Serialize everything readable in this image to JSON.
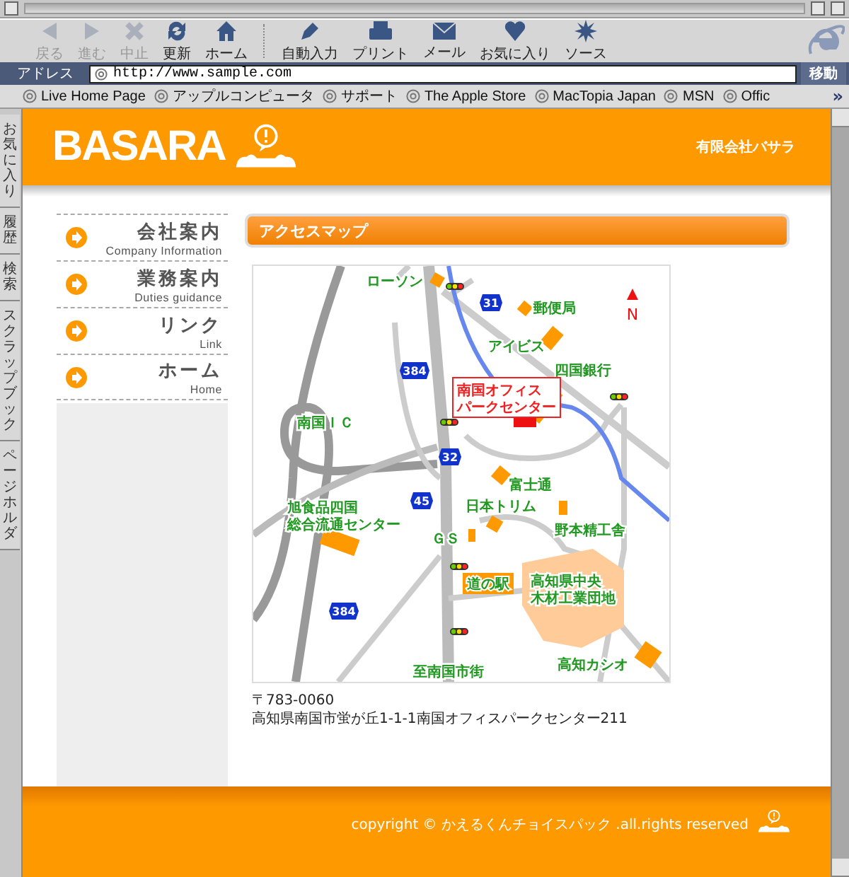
{
  "toolbar": {
    "buttons": [
      {
        "kind": "back",
        "label": "戻る",
        "disabled": true
      },
      {
        "kind": "forward",
        "label": "進む",
        "disabled": true
      },
      {
        "kind": "stop",
        "label": "中止",
        "disabled": true
      },
      {
        "kind": "refresh",
        "label": "更新",
        "disabled": false
      },
      {
        "kind": "home",
        "label": "ホーム",
        "disabled": false
      },
      {
        "kind": "autofill",
        "label": "自動入力",
        "disabled": false
      },
      {
        "kind": "print",
        "label": "プリント",
        "disabled": false
      },
      {
        "kind": "mail",
        "label": "メール",
        "disabled": false
      },
      {
        "kind": "favorites",
        "label": "お気に入り",
        "disabled": false
      },
      {
        "kind": "source",
        "label": "ソース",
        "disabled": false
      }
    ]
  },
  "address_bar": {
    "label": "アドレス",
    "url": "http://www.sample.com",
    "go_button": "移動"
  },
  "favorites_bar": {
    "items": [
      "Live Home Page",
      "アップルコンピュータ",
      "サポート",
      "The Apple Store",
      "MacTopia Japan",
      "MSN",
      "Offic"
    ],
    "more": "»"
  },
  "side_tabs": [
    "お気に入り",
    "履歴",
    "検索",
    "スクラップブック",
    "ページホルダ"
  ],
  "page": {
    "header": {
      "logo": "BASARA",
      "company": "有限会社バサラ"
    },
    "nav": [
      {
        "title": "会社案内",
        "subtitle": "Company Information"
      },
      {
        "title": "業務案内",
        "subtitle": "Duties guidance"
      },
      {
        "title": "リンク",
        "subtitle": "Link"
      },
      {
        "title": "ホーム",
        "subtitle": "Home"
      }
    ],
    "section_title": "アクセスマップ",
    "map": {
      "north": "N",
      "labels": [
        {
          "kind": "place",
          "lines": [
            "ローソン"
          ]
        },
        {
          "kind": "route",
          "lines": [
            "31"
          ]
        },
        {
          "kind": "place",
          "lines": [
            "郵便局"
          ]
        },
        {
          "kind": "place",
          "lines": [
            "アイビス"
          ]
        },
        {
          "kind": "place",
          "lines": [
            "四国銀行"
          ]
        },
        {
          "kind": "route",
          "lines": [
            "384"
          ]
        },
        {
          "kind": "office",
          "lines": [
            "南国オフィス",
            "パークセンター"
          ]
        },
        {
          "kind": "place",
          "lines": [
            "南国ＩＣ"
          ]
        },
        {
          "kind": "route",
          "lines": [
            "32"
          ]
        },
        {
          "kind": "place",
          "lines": [
            "富士通"
          ]
        },
        {
          "kind": "place",
          "lines": [
            "旭食品四国",
            "総合流通センター"
          ]
        },
        {
          "kind": "route",
          "lines": [
            "45"
          ]
        },
        {
          "kind": "place",
          "lines": [
            "日本トリム"
          ]
        },
        {
          "kind": "place",
          "lines": [
            "野本精工舎"
          ]
        },
        {
          "kind": "place",
          "lines": [
            "ＧＳ"
          ]
        },
        {
          "kind": "station",
          "lines": [
            "道の駅"
          ]
        },
        {
          "kind": "place",
          "lines": [
            "高知県中央",
            "木材工業団地"
          ]
        },
        {
          "kind": "route",
          "lines": [
            "384"
          ]
        },
        {
          "kind": "place",
          "lines": [
            "高知カシオ"
          ]
        },
        {
          "kind": "place",
          "lines": [
            "至南国市街"
          ]
        }
      ]
    },
    "address": [
      "〒783-0060",
      "高知県南国市蛍が丘1-1-1南国オフィスパークセンター211"
    ],
    "footer": {
      "copyright": "copyright © かえるくんチョイスパック .all.rights reserved"
    }
  }
}
